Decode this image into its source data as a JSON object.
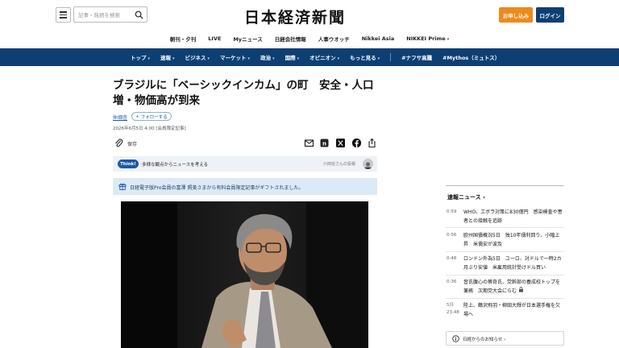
{
  "header": {
    "search_placeholder": "記事・銘柄を検索",
    "logo": "日本経済新聞",
    "apply_label": "お申し込み",
    "login_label": "ログイン"
  },
  "subnav": [
    "朝刊・夕刊",
    "LIVE",
    "Myニュース",
    "日経会社情報",
    "人事ウオッチ",
    "Nikkei Asia",
    "NIKKEI Prime"
  ],
  "mainnav": [
    "トップ",
    "速報",
    "ビジネス",
    "マーケット",
    "政治",
    "国際",
    "オピニオン",
    "もっと見る",
    "#ナフサ高騰",
    "#Mythos（ミュトス）"
  ],
  "article": {
    "title": "ブラジルに「ベーシックインカム」の町　安全・人口増・物価高が到来",
    "author": "仲畑杏",
    "follow_label": "フォローする",
    "date": "2026年6月5日 4:00",
    "members_only": "[会員限定記事]",
    "save_label": "保存",
    "think_badge": "Think!",
    "think_text": "多様な観点からニュースを考える",
    "think_post": "六田信さんの投稿",
    "gift_text": "日経電子版Pro会員の富澤 照美さまから有料会員限定記事がギフトされました。"
  },
  "sidebar": {
    "heading": "速報ニュース",
    "items": [
      {
        "time": "0:59",
        "text": "WHO、エボラ対策に830億円　感染検査や患者との接触を追跡"
      },
      {
        "time": "0:56",
        "text": "欧州国債概況5日　独10年債利回り、小幅上昇　米債安が波及"
      },
      {
        "time": "0:48",
        "text": "ロンドン外為5日　ユーロ、対ドルで一時2カ月ぶり安値　米雇用統計受けドル買い"
      },
      {
        "time": "0:36",
        "text": "習氏腹心の蔡奇氏、党幹部の養成校トップを兼務　次期党大会にらむ"
      },
      {
        "time": "5日 23:48",
        "text": "陸上、鶴沢飛羽・柳田大輝が日本選手権を欠場へ"
      }
    ],
    "notice": "日経からのお知らせ"
  }
}
